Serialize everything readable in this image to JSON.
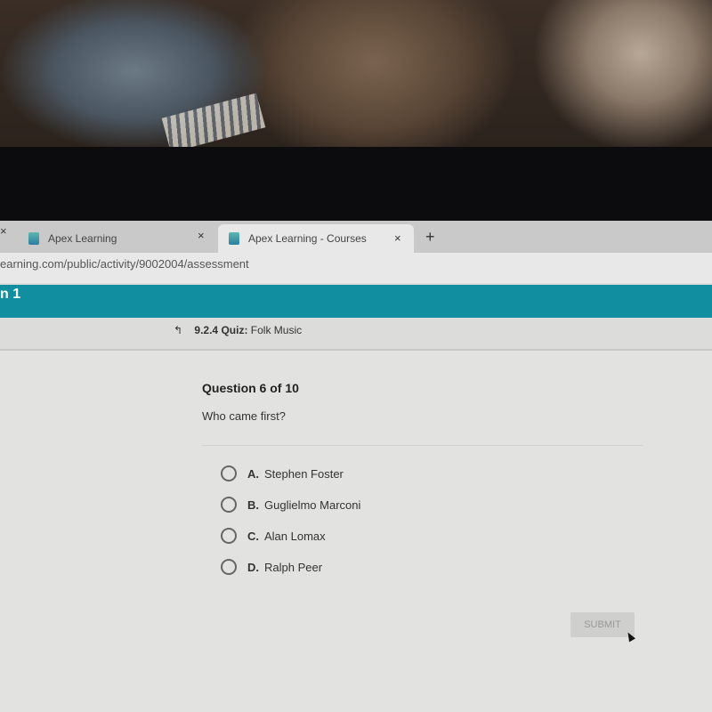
{
  "browser": {
    "tabs": [
      {
        "label": "Apex Learning",
        "active": false
      },
      {
        "label": "Apex Learning - Courses",
        "active": true
      }
    ],
    "close_glyph": "×",
    "new_tab_glyph": "+",
    "url": "earning.com/public/activity/9002004/assessment"
  },
  "header": {
    "title_fragment": "n 1",
    "accent": "#118ea0"
  },
  "breadcrumb": {
    "icon": "up-arrow-icon",
    "code": "9.2.4",
    "type": "Quiz:",
    "title": "Folk Music"
  },
  "question": {
    "number": "Question 6 of 10",
    "text": "Who came first?",
    "options": [
      {
        "letter": "A.",
        "text": "Stephen Foster"
      },
      {
        "letter": "B.",
        "text": "Guglielmo Marconi"
      },
      {
        "letter": "C.",
        "text": "Alan Lomax"
      },
      {
        "letter": "D.",
        "text": "Ralph Peer"
      }
    ]
  },
  "submit_label": "SUBMIT"
}
